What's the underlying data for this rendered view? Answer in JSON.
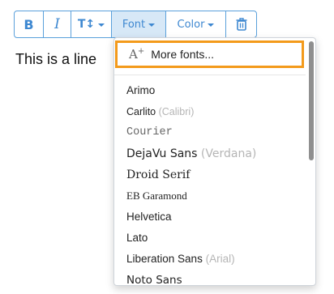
{
  "toolbar": {
    "bold_label": "B",
    "italic_label": "I",
    "size_label": "T↕",
    "font_label": "Font",
    "color_label": "Color"
  },
  "editor": {
    "line_text": "This is a line"
  },
  "font_menu": {
    "more_fonts_label": "More fonts...",
    "items": [
      {
        "name": "Arimo",
        "alias": ""
      },
      {
        "name": "Carlito",
        "alias": "(Calibri)"
      },
      {
        "name": "Courier",
        "alias": ""
      },
      {
        "name": "DejaVu Sans",
        "alias": "(Verdana)"
      },
      {
        "name": "Droid Serif",
        "alias": ""
      },
      {
        "name": "EB Garamond",
        "alias": ""
      },
      {
        "name": "Helvetica",
        "alias": ""
      },
      {
        "name": "Lato",
        "alias": ""
      },
      {
        "name": "Liberation Sans",
        "alias": "(Arial)"
      },
      {
        "name": "Noto Sans",
        "alias": ""
      }
    ]
  },
  "colors": {
    "accent": "#3e88d1",
    "highlight": "#f39a1b"
  }
}
